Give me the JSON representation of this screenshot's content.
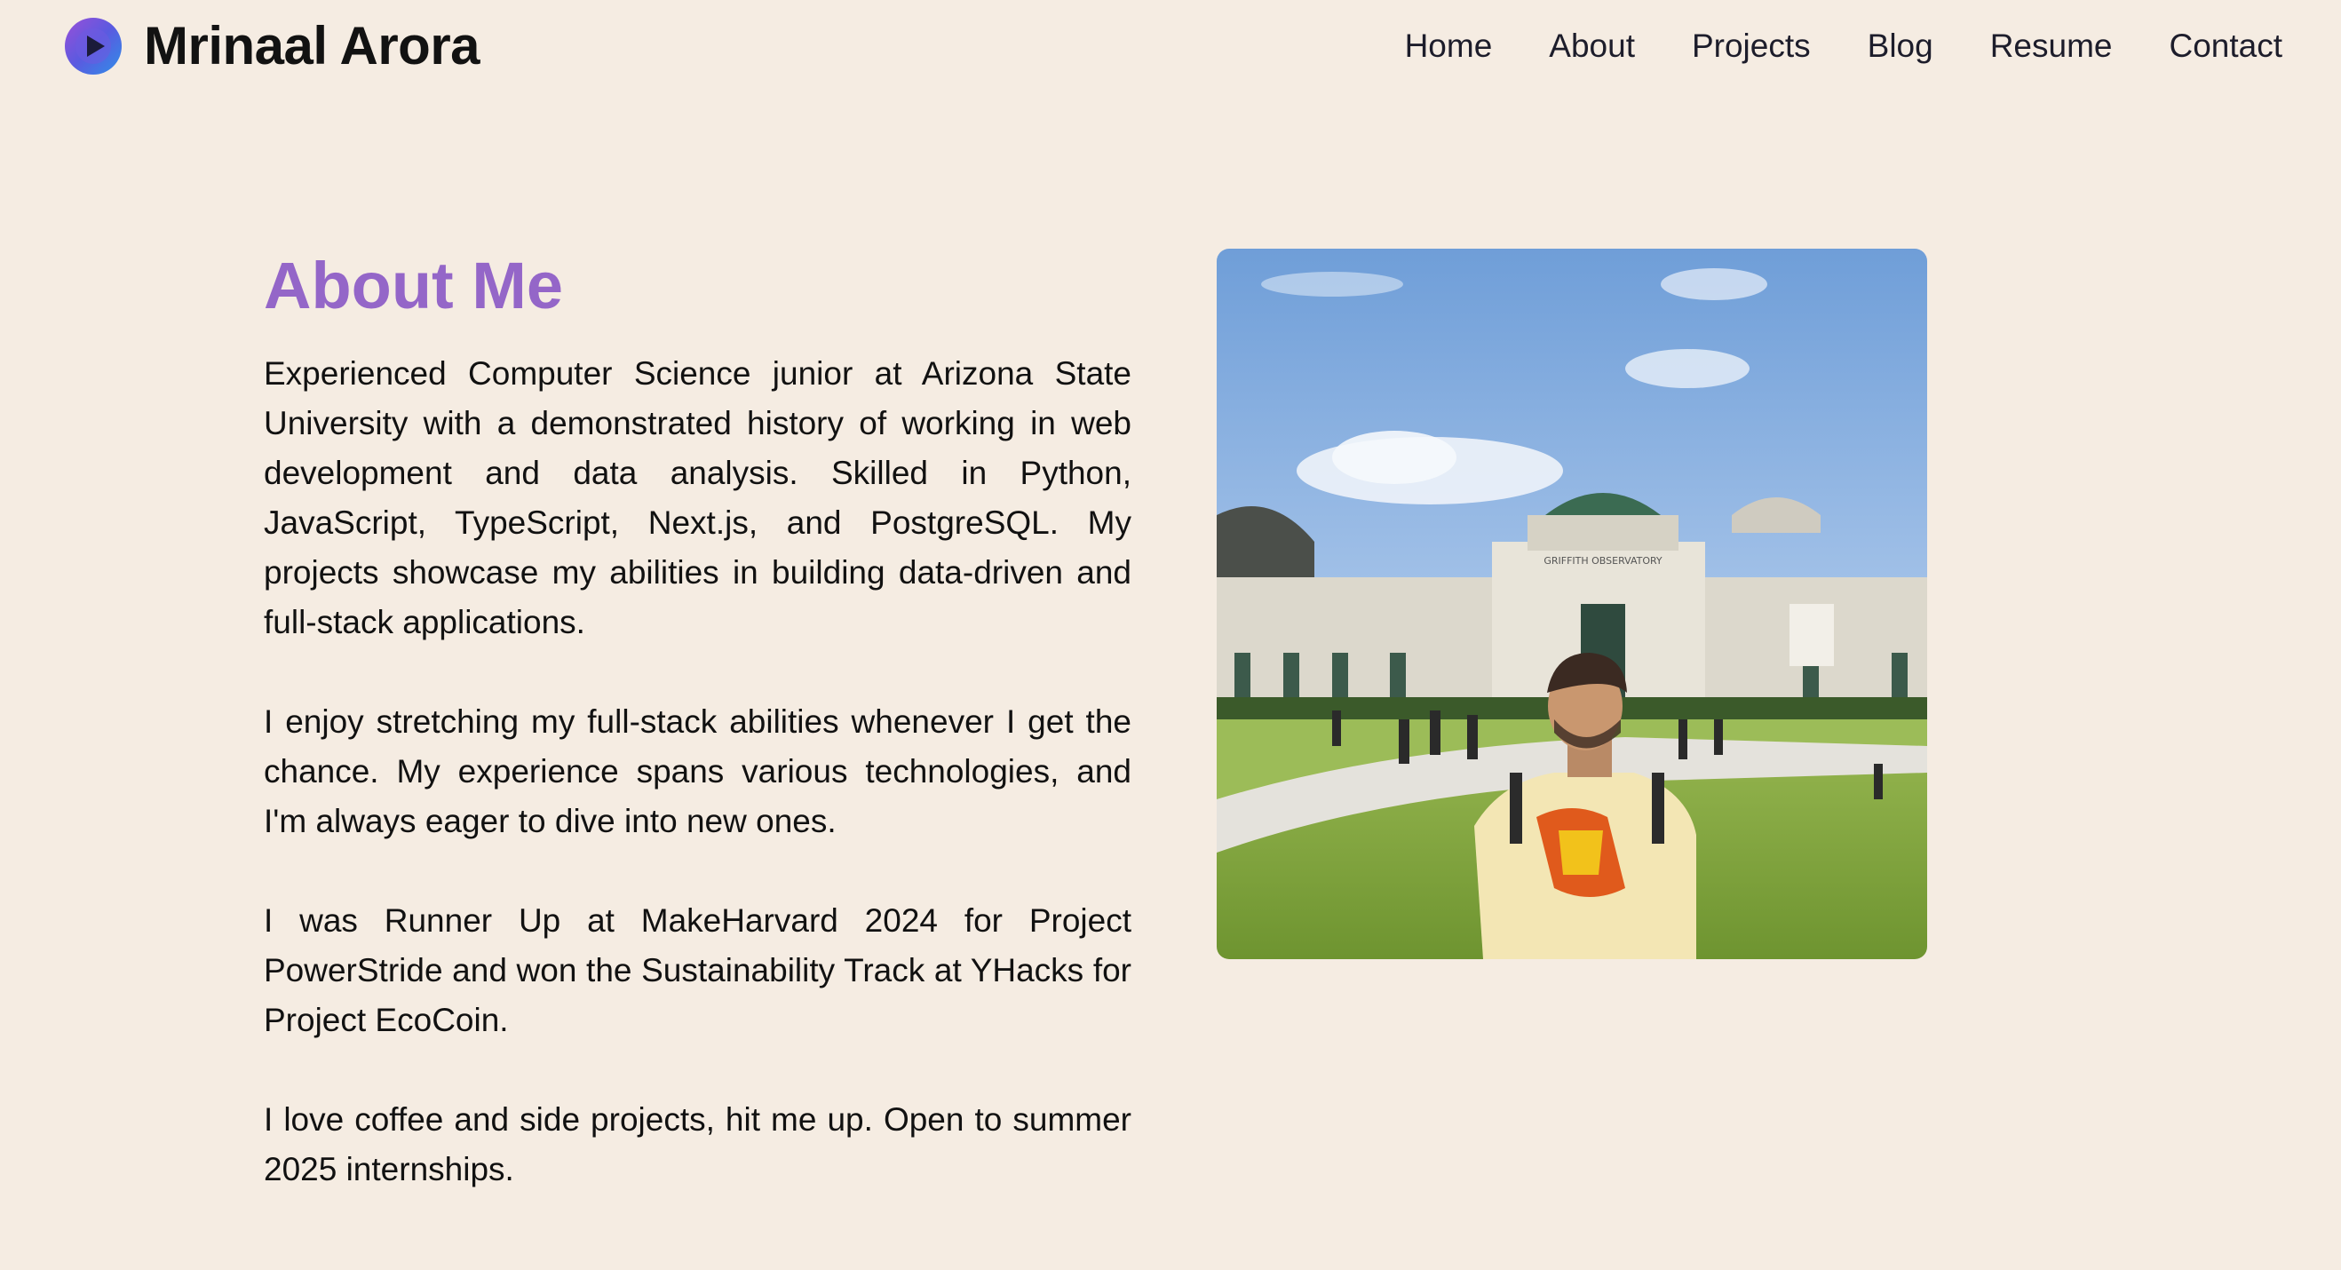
{
  "header": {
    "brand": "Mrinaal Arora",
    "logo_icon": "play-circle-logo-icon",
    "nav": [
      {
        "label": "Home"
      },
      {
        "label": "About"
      },
      {
        "label": "Projects"
      },
      {
        "label": "Blog"
      },
      {
        "label": "Resume"
      },
      {
        "label": "Contact"
      }
    ]
  },
  "about": {
    "title": "About Me",
    "paragraphs": [
      "Experienced Computer Science junior at Arizona State University with a demonstrated history of working in web development and data analysis. Skilled in Python, JavaScript, TypeScript, Next.js, and PostgreSQL. My projects showcase my abilities in building data-driven and full-stack applications.",
      "I enjoy stretching my full-stack abilities whenever I get the chance. My experience spans various technologies, and I'm always eager to dive into new ones.",
      "I was Runner Up at MakeHarvard 2024 for Project PowerStride and won the Sustainability Track at YHacks for Project EcoCoin.",
      "I love coffee and side projects, hit me up. Open to summer 2025 internships."
    ],
    "photo": {
      "building_sign": "GRIFFITH OBSERVATORY"
    }
  },
  "colors": {
    "background": "#f5ece2",
    "accent": "#9466c8",
    "text": "#111111"
  }
}
